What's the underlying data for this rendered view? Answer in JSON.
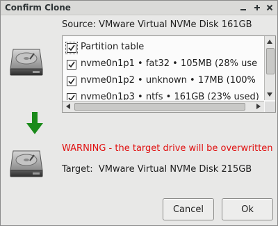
{
  "window": {
    "title": "Confirm Clone",
    "controls": [
      "minimize",
      "maximize",
      "close"
    ]
  },
  "source": {
    "label": "Source:",
    "disk_name": "VMware Virtual NVMe Disk 161GB"
  },
  "partitions": {
    "items": [
      {
        "label": "Partition table",
        "checked": true
      },
      {
        "label": "nvme0n1p1 • fat32 • 105MB (28% use",
        "checked": true
      },
      {
        "label": "nvme0n1p2 • unknown • 17MB (100%",
        "checked": true
      },
      {
        "label": "nvme0n1p3 • ntfs • 161GB (23% used)",
        "checked": true
      }
    ],
    "scrollbar_position": 0
  },
  "warning": {
    "text": "WARNING - the target drive will be overwritten"
  },
  "target": {
    "label": "Target:",
    "disk_name": "VMware Virtual NVMe Disk 215GB"
  },
  "buttons": {
    "cancel": "Cancel",
    "ok": "Ok"
  },
  "colors": {
    "warning": "#e01010",
    "arrow": "#1a8a1a",
    "window_bg": "#e8e8e7"
  },
  "icons": [
    "hard-drive-icon",
    "down-arrow-icon",
    "checkbox-checked-icon"
  ]
}
